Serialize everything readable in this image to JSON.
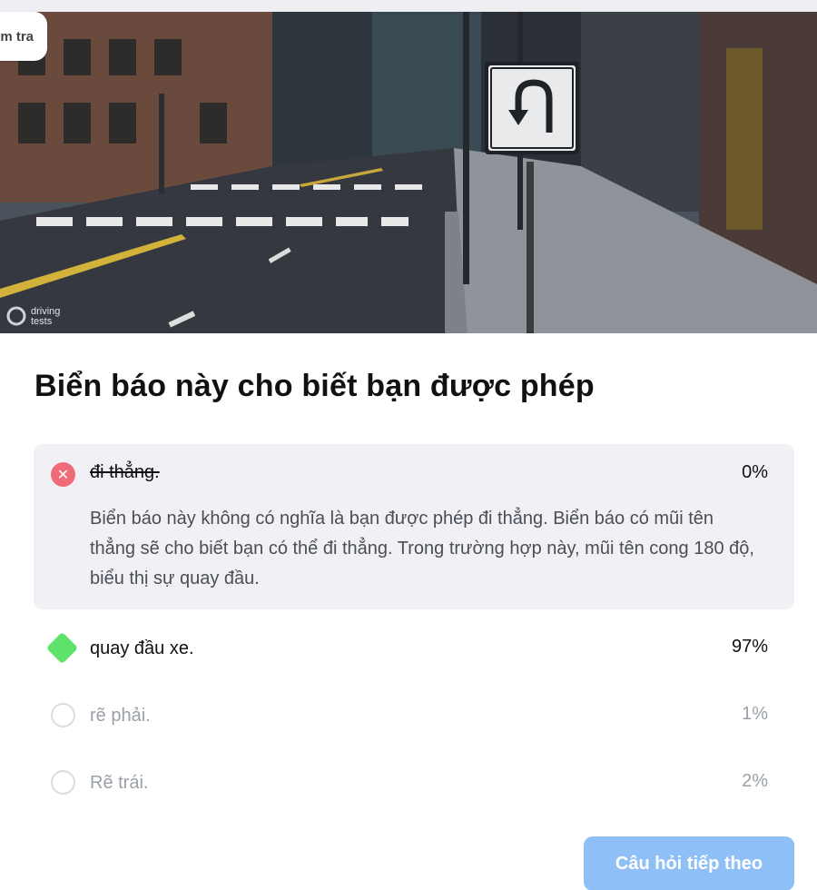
{
  "header": {
    "tab_label": "m tra",
    "watermark_line1": "driving",
    "watermark_line2": "tests"
  },
  "icons": {
    "sign": "u-turn-sign-icon",
    "wrong": "close-icon",
    "correct": "diamond-check-icon",
    "unselected": "radio-empty-icon"
  },
  "question": {
    "text": "Biển báo này cho biết bạn được phép"
  },
  "answers": [
    {
      "label": "đi thẳng.",
      "percent": "0%",
      "state": "wrong",
      "explanation": "Biển báo này không có nghĩa là bạn được phép đi thẳng. Biển báo có mũi tên thẳng sẽ cho biết bạn có thể đi thẳng. Trong trường hợp này, mũi tên cong 180 độ, biểu thị sự quay đầu."
    },
    {
      "label": "quay đầu xe.",
      "percent": "97%",
      "state": "correct"
    },
    {
      "label": "rẽ phải.",
      "percent": "1%",
      "state": "unselected"
    },
    {
      "label": "Rẽ trái.",
      "percent": "2%",
      "state": "unselected"
    }
  ],
  "footer": {
    "next_label": "Câu hỏi tiếp theo"
  },
  "colors": {
    "wrong": "#ef6b78",
    "correct": "#5ee36a",
    "button": "#8ec0f7",
    "expanded_bg": "#f1f0f5"
  }
}
